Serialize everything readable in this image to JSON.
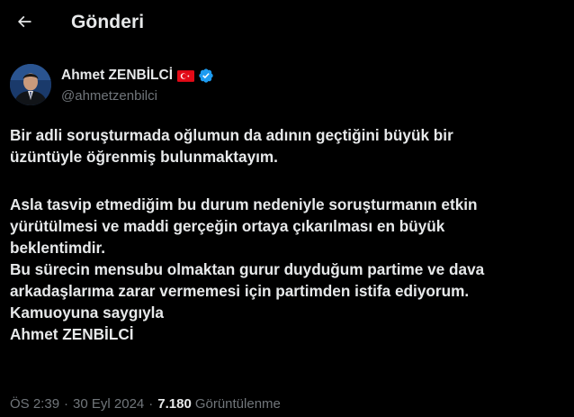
{
  "header": {
    "title": "Gönderi",
    "back_icon": "arrow-left-icon"
  },
  "author": {
    "display_name": "Ahmet ZENBİLCİ",
    "handle": "@ahmetzenbilci",
    "flag_icon": "turkey-flag-icon",
    "verified_icon": "verified-badge-icon",
    "verified_color": "#1d9bf0"
  },
  "tweet": {
    "lines": [
      "Bir adli soruşturmada oğlumun da adının geçtiğini büyük bir",
      "üzüntüyle öğrenmiş bulunmaktayım.",
      "",
      "Asla tasvip etmediğim bu durum nedeniyle soruşturmanın etkin",
      "yürütülmesi ve maddi gerçeğin ortaya çıkarılması en büyük",
      "beklentimdir.",
      "Bu sürecin mensubu olmaktan gurur duyduğum partime ve dava",
      "arkadaşlarıma zarar vermemesi için partimden istifa ediyorum.",
      "Kamuoyuna saygıyla",
      "Ahmet ZENBİLCİ"
    ]
  },
  "meta": {
    "time": "ÖS 2:39",
    "separator": "·",
    "date": "30 Eyl 2024",
    "views_count": "7.180",
    "views_label": "Görüntülenme"
  },
  "colors": {
    "background": "#000000",
    "text_primary": "#e7e9ea",
    "text_secondary": "#71767b",
    "accent": "#1d9bf0"
  }
}
